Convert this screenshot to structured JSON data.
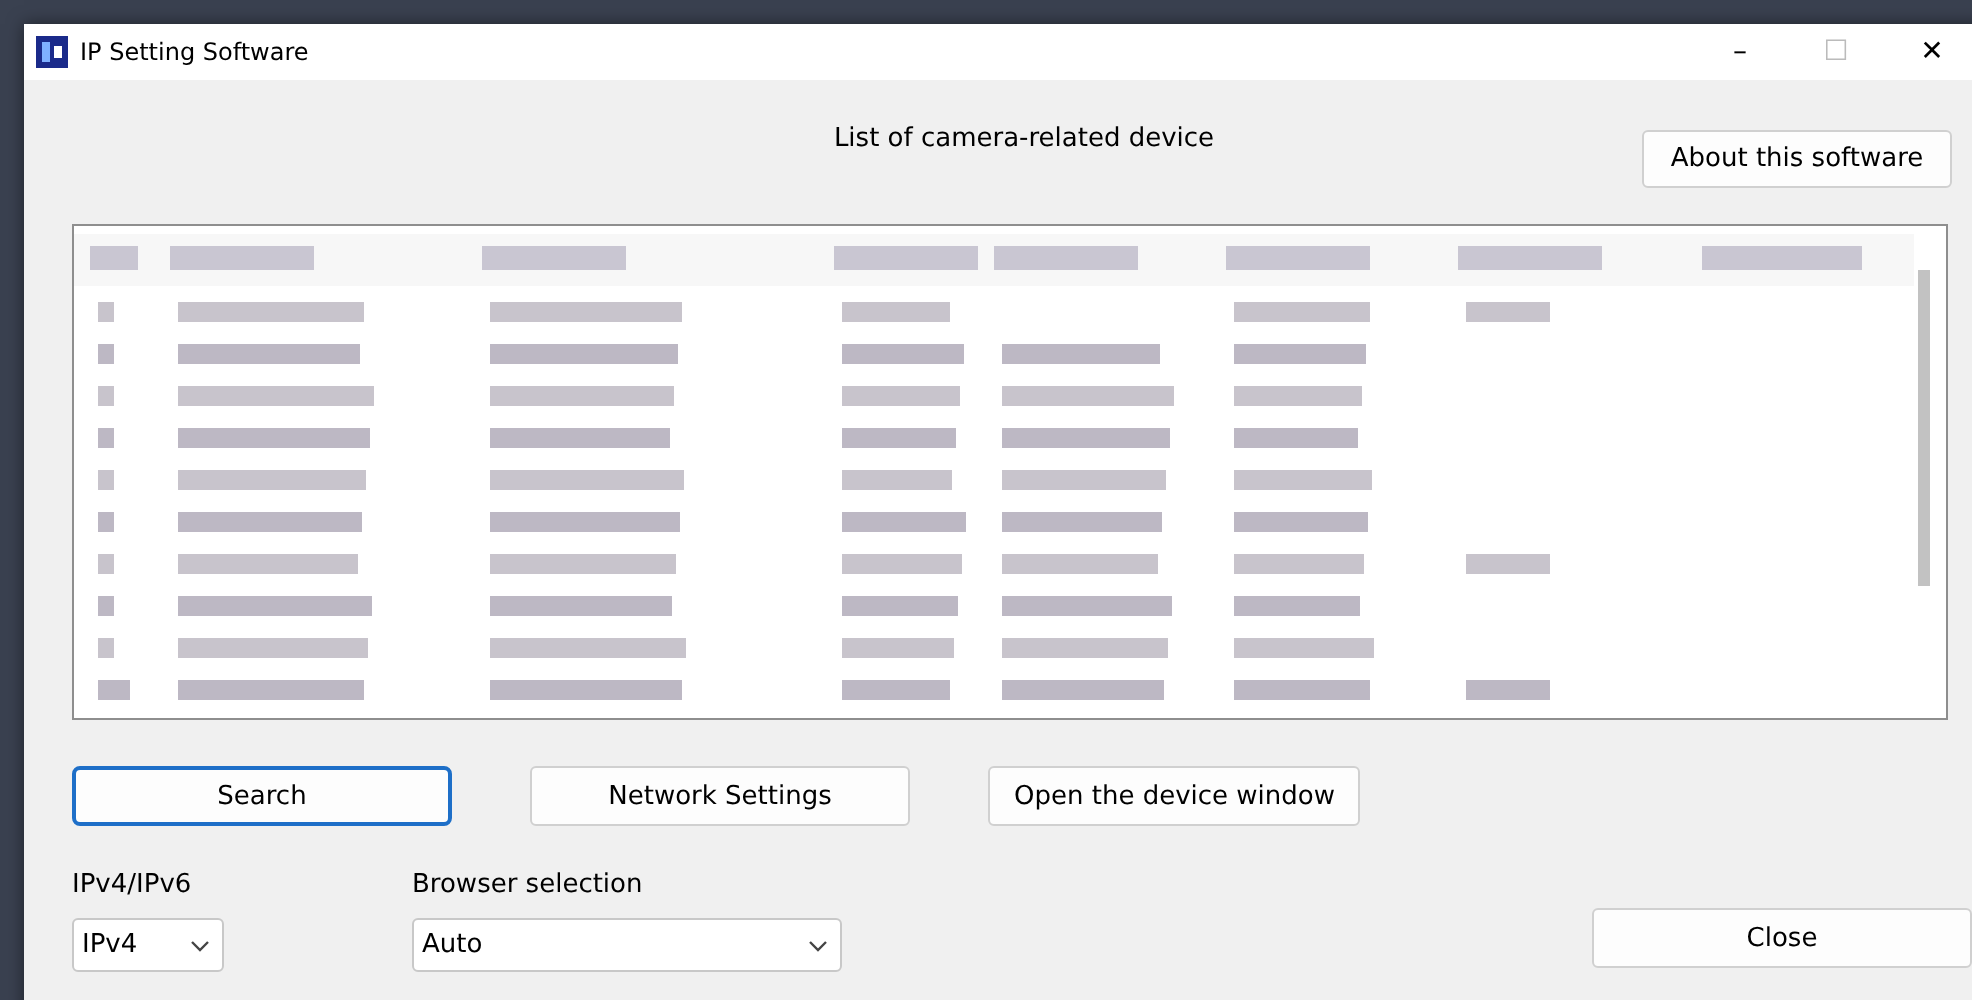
{
  "window": {
    "title": "IP Setting Software",
    "controls": [
      "–",
      "☐",
      "✕"
    ]
  },
  "heading": "List of camera-related device",
  "about_button": "About this software",
  "buttons": [
    {
      "label": "Search",
      "focused": true
    },
    {
      "label": "Network Settings",
      "focused": false
    },
    {
      "label": "Open the device window",
      "focused": false
    }
  ],
  "ip_version": {
    "label": "IPv4/IPv6",
    "value": "IPv4"
  },
  "browser": {
    "label": "Browser selection",
    "value": "Auto"
  },
  "close_button": "Close"
}
